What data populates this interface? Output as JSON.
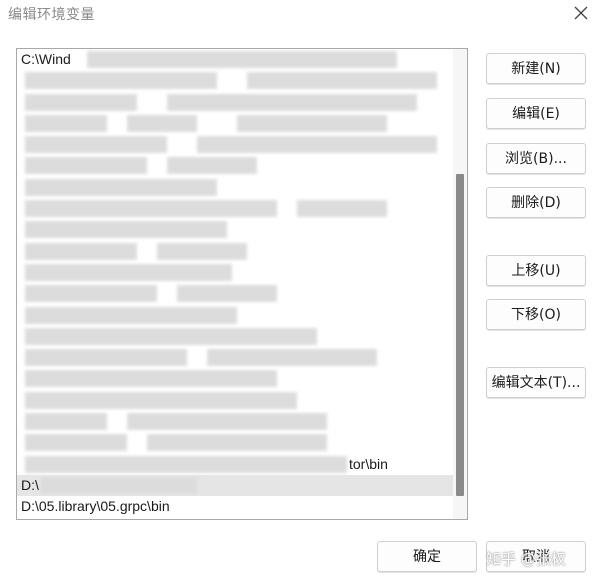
{
  "window": {
    "title": "编辑环境变量"
  },
  "list": {
    "items": [
      {
        "text": "C:\\Wind"
      },
      {
        "text": ""
      },
      {
        "text": ""
      },
      {
        "text": ""
      },
      {
        "text": ""
      },
      {
        "text": ""
      },
      {
        "text": ""
      },
      {
        "text": ""
      },
      {
        "text": ""
      },
      {
        "text": ""
      },
      {
        "text": ""
      },
      {
        "text": ""
      },
      {
        "text": ""
      },
      {
        "text": ""
      },
      {
        "text": ""
      },
      {
        "text": ""
      },
      {
        "text": ""
      },
      {
        "text": ""
      },
      {
        "text": ""
      },
      {
        "text": "tor\\bin"
      },
      {
        "text": "D:\\"
      },
      {
        "text": "D:\\05.library\\05.grpc\\bin"
      }
    ],
    "selected_index": 20
  },
  "buttons": {
    "new": "新建(N)",
    "edit": "编辑(E)",
    "browse": "浏览(B)...",
    "delete": "删除(D)",
    "move_up": "上移(U)",
    "move_down": "下移(O)",
    "edit_text": "编辑文本(T)...",
    "ok": "确定",
    "cancel": "取消"
  },
  "watermark": "知乎 @张权"
}
